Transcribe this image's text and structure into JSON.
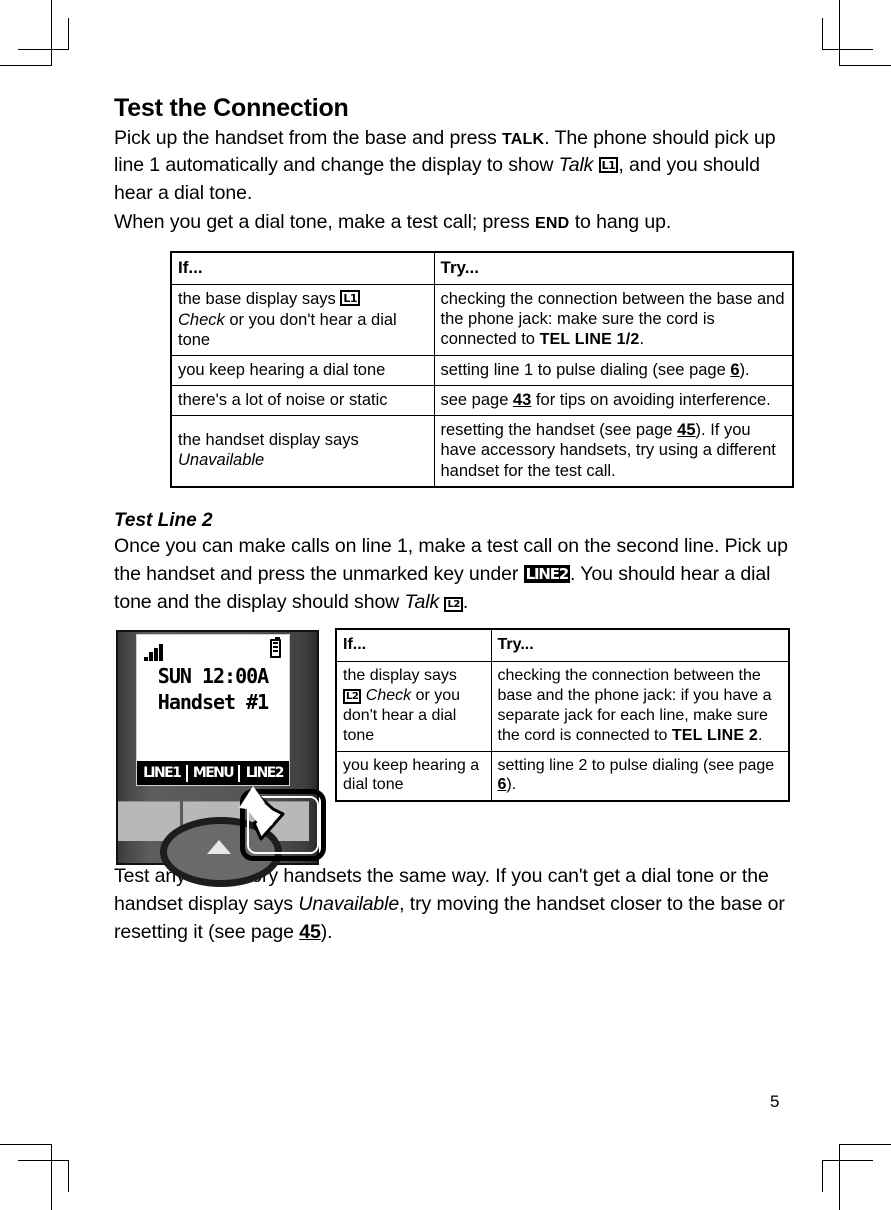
{
  "page": {
    "number": "5",
    "heading": "Test the Connection",
    "intro_para_1": {
      "t1": "Pick up the handset from the base and press ",
      "smallcaps1": "TALK",
      "t2": ". The phone should pick up line 1 automatically and change the display to show ",
      "italic1": "Talk",
      "icon1": "L1",
      "t3": ", and you should hear a dial tone."
    },
    "intro_para_2": {
      "t1": "When you get a dial tone, make a test call; press ",
      "smallcaps1": "END",
      "t2": " to hang up."
    },
    "subheading": "Test Line 2",
    "line2_para": {
      "t1": "Once you can make calls on line 1, make a test call on the second line. Pick up the handset and press the unmarked key under ",
      "softkey": "LINE2",
      "t2": ". You should hear a dial tone and the display should show ",
      "italic1": "Talk",
      "icon1": "L2",
      "t3": "."
    },
    "closing_para": {
      "t1": "Test any accessory handsets the same way. If you can't get a dial tone or the handset display says ",
      "italic1": "Unavailable",
      "t2": ", try moving the handset closer to the base or resetting it (see page ",
      "pagelink": "45",
      "t3": ")."
    }
  },
  "table_1": {
    "headers": [
      "If...",
      "Try..."
    ],
    "rows": [
      {
        "if": {
          "t1": "the base display says ",
          "icon": "L1",
          "t2": "",
          "italic": "Check",
          "t3": " or you don't hear a dial tone"
        },
        "try": {
          "t1": "checking the connection between the base and the phone jack: make sure the cord is connected to ",
          "bold": "TEL LINE 1/2",
          "t2": "."
        }
      },
      {
        "if": {
          "t1": "you keep hearing a dial tone"
        },
        "try": {
          "t1": "setting line 1 to pulse dialing (see page ",
          "pagelink": "6",
          "t2": ")."
        }
      },
      {
        "if": {
          "t1": "there's a lot of noise or static"
        },
        "try": {
          "t1": "see page ",
          "pagelink": "43",
          "t2": " for tips on avoiding interference."
        }
      },
      {
        "if": {
          "t1": "the handset display says ",
          "italic": "Unavailable"
        },
        "try": {
          "t1": "resetting the handset (see page ",
          "pagelink": "45",
          "t2": "). If you have accessory handsets, try using a different handset for the test call."
        }
      }
    ]
  },
  "table_2": {
    "headers": [
      "If...",
      "Try..."
    ],
    "rows": [
      {
        "if": {
          "t1": "the display says ",
          "icon": "L2",
          "italic": "Check",
          "t2": " or you don't hear a dial tone"
        },
        "try": {
          "t1": "checking the connection between the base and the phone jack: if you have a separate jack for each line, make sure the cord is connected to ",
          "bold": "TEL LINE 2",
          "t2": "."
        }
      },
      {
        "if": {
          "t1": "you keep hearing a dial tone"
        },
        "try": {
          "t1": "setting line 2 to pulse dialing (see page ",
          "pagelink": "6",
          "t2": ")."
        }
      }
    ]
  },
  "phone_figure": {
    "display": {
      "line_1": "SUN 12:00A",
      "line_2": "Handset #1",
      "signal_icon": "signal-bars-icon",
      "battery_icon": "battery-full-icon",
      "softkeys": [
        "LINE1",
        "MENU",
        "LINE2"
      ]
    },
    "callout": "highlight-right-softkey"
  }
}
